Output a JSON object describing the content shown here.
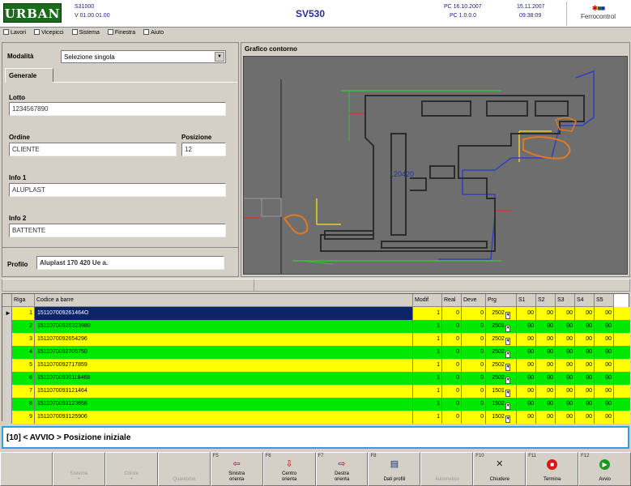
{
  "header": {
    "logo": "URBAN",
    "version_line1": "S31000",
    "version_line2": "V 01.00.01.00",
    "title": "SV530",
    "pc_line1": "PC 16.10.2007",
    "pc_line2": "PC 1.0.0.0",
    "date": "15.11.2007",
    "time": "09:38:09",
    "brand": "Ferrocontrol",
    "brand_color": "#cc0000"
  },
  "menu": {
    "items": [
      "Lavori",
      "Vicepicci",
      "Sistema",
      "Finestra",
      "Aiuto"
    ]
  },
  "left": {
    "modalita_label": "Modalità",
    "modalita_value": "Selezione singola",
    "tab_generale": "Generale",
    "lotto_label": "Lotto",
    "lotto_value": "1234567890",
    "ordine_label": "Ordine",
    "ordine_value": "CLIENTE",
    "posizione_label": "Posizione",
    "posizione_value": "12",
    "info1_label": "Info 1",
    "info1_value": "ALUPLAST",
    "info2_label": "Info 2",
    "info2_value": "BATTENTE",
    "profilo_label": "Profilo",
    "profilo_value": "Aluplast 170 420 Ue a."
  },
  "graph": {
    "title": "Grafico contorno",
    "code": "120420"
  },
  "table": {
    "headers": [
      "Riga",
      "Codice a barre",
      "Modif",
      "Real",
      "Deve",
      "Prg",
      "S1",
      "S2",
      "S3",
      "S4",
      "S5"
    ],
    "rows": [
      {
        "riga": "1",
        "codice": "151107009261464O",
        "modif": "1",
        "real": "0",
        "deve": "0",
        "prg": "2502",
        "s": [
          "00",
          "00",
          "00",
          "00",
          "00"
        ]
      },
      {
        "riga": "2",
        "codice": "15110700926323980",
        "modif": "1",
        "real": "0",
        "deve": "0",
        "prg": "2501",
        "s": [
          "00",
          "00",
          "00",
          "00",
          "00"
        ]
      },
      {
        "riga": "3",
        "codice": "1511070092654296",
        "modif": "1",
        "real": "0",
        "deve": "0",
        "prg": "2502",
        "s": [
          "00",
          "00",
          "00",
          "00",
          "00"
        ]
      },
      {
        "riga": "4",
        "codice": "1511070092705750",
        "modif": "1",
        "real": "0",
        "deve": "0",
        "prg": "2502",
        "s": [
          "00",
          "00",
          "00",
          "00",
          "00"
        ]
      },
      {
        "riga": "5",
        "codice": "1511070092717859",
        "modif": "1",
        "real": "0",
        "deve": "0",
        "prg": "2502",
        "s": [
          "00",
          "00",
          "00",
          "00",
          "00"
        ]
      },
      {
        "riga": "6",
        "codice": "15110700930118468",
        "modif": "1",
        "real": "0",
        "deve": "0",
        "prg": "2502",
        "s": [
          "00",
          "00",
          "00",
          "00",
          "00"
        ]
      },
      {
        "riga": "7",
        "codice": "1511070093121464",
        "modif": "1",
        "real": "0",
        "deve": "0",
        "prg": "1501",
        "s": [
          "00",
          "00",
          "00",
          "00",
          "00"
        ]
      },
      {
        "riga": "8",
        "codice": "1511070093123656",
        "modif": "1",
        "real": "0",
        "deve": "0",
        "prg": "1502",
        "s": [
          "00",
          "00",
          "00",
          "00",
          "00"
        ]
      },
      {
        "riga": "9",
        "codice": "1511070093125906",
        "modif": "1",
        "real": "0",
        "deve": "0",
        "prg": "1502",
        "s": [
          "00",
          "00",
          "00",
          "00",
          "00"
        ]
      }
    ]
  },
  "status": {
    "message": "[10] < AVVIO > Posizione iniziale"
  },
  "fkeys": [
    {
      "fn": "",
      "label1": "",
      "label2": "",
      "enabled": false,
      "icon": "none"
    },
    {
      "fn": "",
      "label1": "Sistema",
      "label2": "+",
      "enabled": false,
      "icon": "none"
    },
    {
      "fn": "",
      "label1": "Colore",
      "label2": "+",
      "enabled": false,
      "icon": "none"
    },
    {
      "fn": "",
      "label1": "Quantome",
      "label2": "",
      "enabled": false,
      "icon": "none"
    },
    {
      "fn": "F5",
      "label1": "Sinistra",
      "label2": "orienta",
      "enabled": true,
      "icon": "arrow-left-icon"
    },
    {
      "fn": "F6",
      "label1": "Centro",
      "label2": "orienta",
      "enabled": true,
      "icon": "arrow-down-icon"
    },
    {
      "fn": "F7",
      "label1": "Destra",
      "label2": "orienta",
      "enabled": true,
      "icon": "arrow-right-icon"
    },
    {
      "fn": "F8",
      "label1": "Dati profili",
      "label2": "",
      "enabled": true,
      "icon": "document-icon"
    },
    {
      "fn": "",
      "label1": "Automatico",
      "label2": "",
      "enabled": false,
      "icon": "none"
    },
    {
      "fn": "F10",
      "label1": "Chiudere",
      "label2": "",
      "enabled": true,
      "icon": "close-icon"
    },
    {
      "fn": "F11",
      "label1": "Termina",
      "label2": "",
      "enabled": true,
      "icon": "stop-icon"
    },
    {
      "fn": "F12",
      "label1": "Avvio",
      "label2": "",
      "enabled": true,
      "icon": "go-icon"
    }
  ],
  "colors": {
    "row_yellow": "#ffff00",
    "row_green": "#00e800",
    "row_selected": "#0a246a",
    "status_border": "#2fa0d8",
    "logo_bg": "#1a6b1a"
  }
}
